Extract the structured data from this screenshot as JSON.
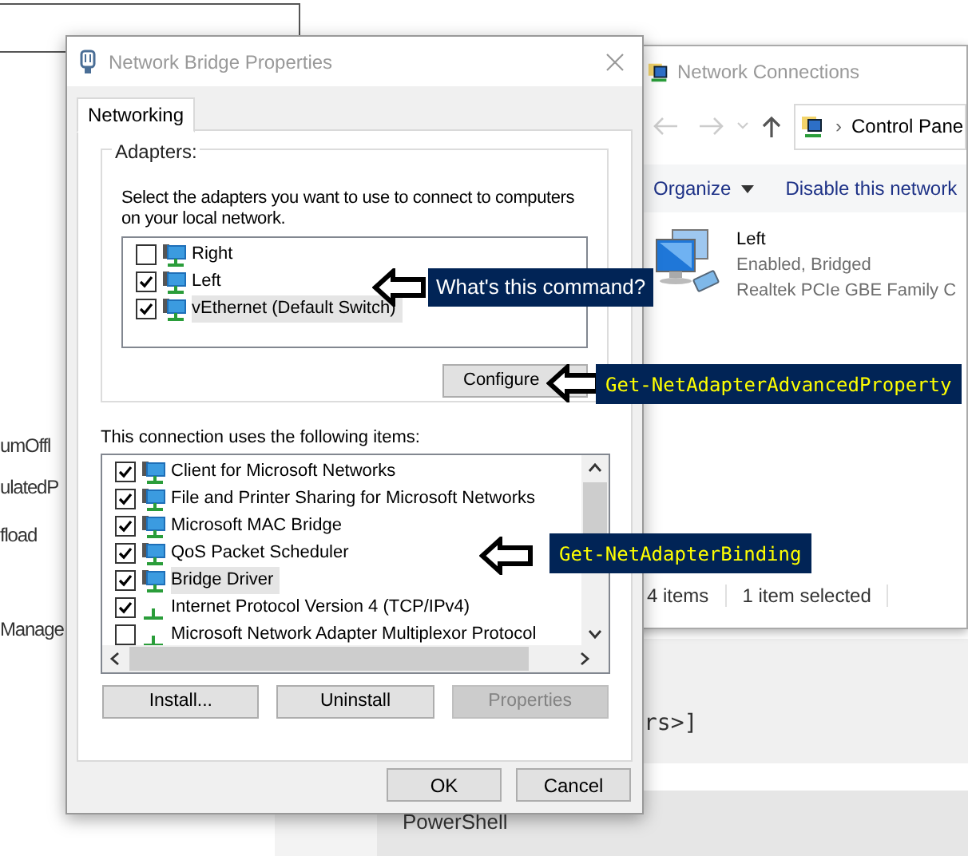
{
  "background": {
    "fragments": [
      "umOffl",
      "ulatedP",
      "fload",
      "Manage"
    ],
    "console_text": "rs>]",
    "tab_label": "PowerShell"
  },
  "explorer": {
    "title": "Network Connections",
    "address": "Control Pane",
    "breadcrumb_separator": "›",
    "toolbar": [
      {
        "label": "Organize",
        "dropdown": true
      },
      {
        "label": "Disable this network",
        "dropdown": false
      }
    ],
    "item": {
      "name": "Left",
      "status": "Enabled, Bridged",
      "device": "Realtek PCIe GBE Family C"
    },
    "status_bar": [
      "4 items",
      "1 item selected"
    ]
  },
  "dialog": {
    "title": "Network Bridge Properties",
    "tabs": [
      {
        "label": "Networking",
        "selected": true
      }
    ],
    "adapters_group": "Adapters:",
    "adapters_hint": "Select the adapters you want to use to connect to computers on your local network.",
    "adapters": [
      {
        "name": "Right",
        "checked": false,
        "selected": false
      },
      {
        "name": "Left",
        "checked": true,
        "selected": false
      },
      {
        "name": "vEthernet (Default Switch)",
        "checked": true,
        "selected": true
      }
    ],
    "configure": {
      "label": "Configure",
      "disabled": false
    },
    "items_label": "This connection uses the following items:",
    "items": [
      {
        "name": "Client for Microsoft Networks",
        "kind": "adapter",
        "checked": true,
        "selected": false
      },
      {
        "name": "File and Printer Sharing for Microsoft Networks",
        "kind": "adapter",
        "checked": true,
        "selected": false
      },
      {
        "name": "Microsoft MAC Bridge",
        "kind": "adapter",
        "checked": true,
        "selected": false
      },
      {
        "name": "QoS Packet Scheduler",
        "kind": "adapter",
        "checked": true,
        "selected": false
      },
      {
        "name": "Bridge Driver",
        "kind": "adapter",
        "checked": true,
        "selected": true
      },
      {
        "name": "Internet Protocol Version 4 (TCP/IPv4)",
        "kind": "protocol",
        "checked": true,
        "selected": false
      },
      {
        "name": "Microsoft Network Adapter Multiplexor Protocol",
        "kind": "protocol",
        "checked": false,
        "selected": false
      }
    ],
    "item_buttons": [
      {
        "label": "Install...",
        "disabled": false
      },
      {
        "label": "Uninstall",
        "disabled": false
      },
      {
        "label": "Properties",
        "disabled": true
      }
    ],
    "footer_buttons": [
      {
        "label": "OK"
      },
      {
        "label": "Cancel"
      }
    ]
  },
  "annotations": [
    {
      "text": "What's this command?",
      "kind": "prose"
    },
    {
      "text": "Get-NetAdapterAdvancedProperty",
      "kind": "code"
    },
    {
      "text": "Get-NetAdapterBinding",
      "kind": "code"
    }
  ]
}
